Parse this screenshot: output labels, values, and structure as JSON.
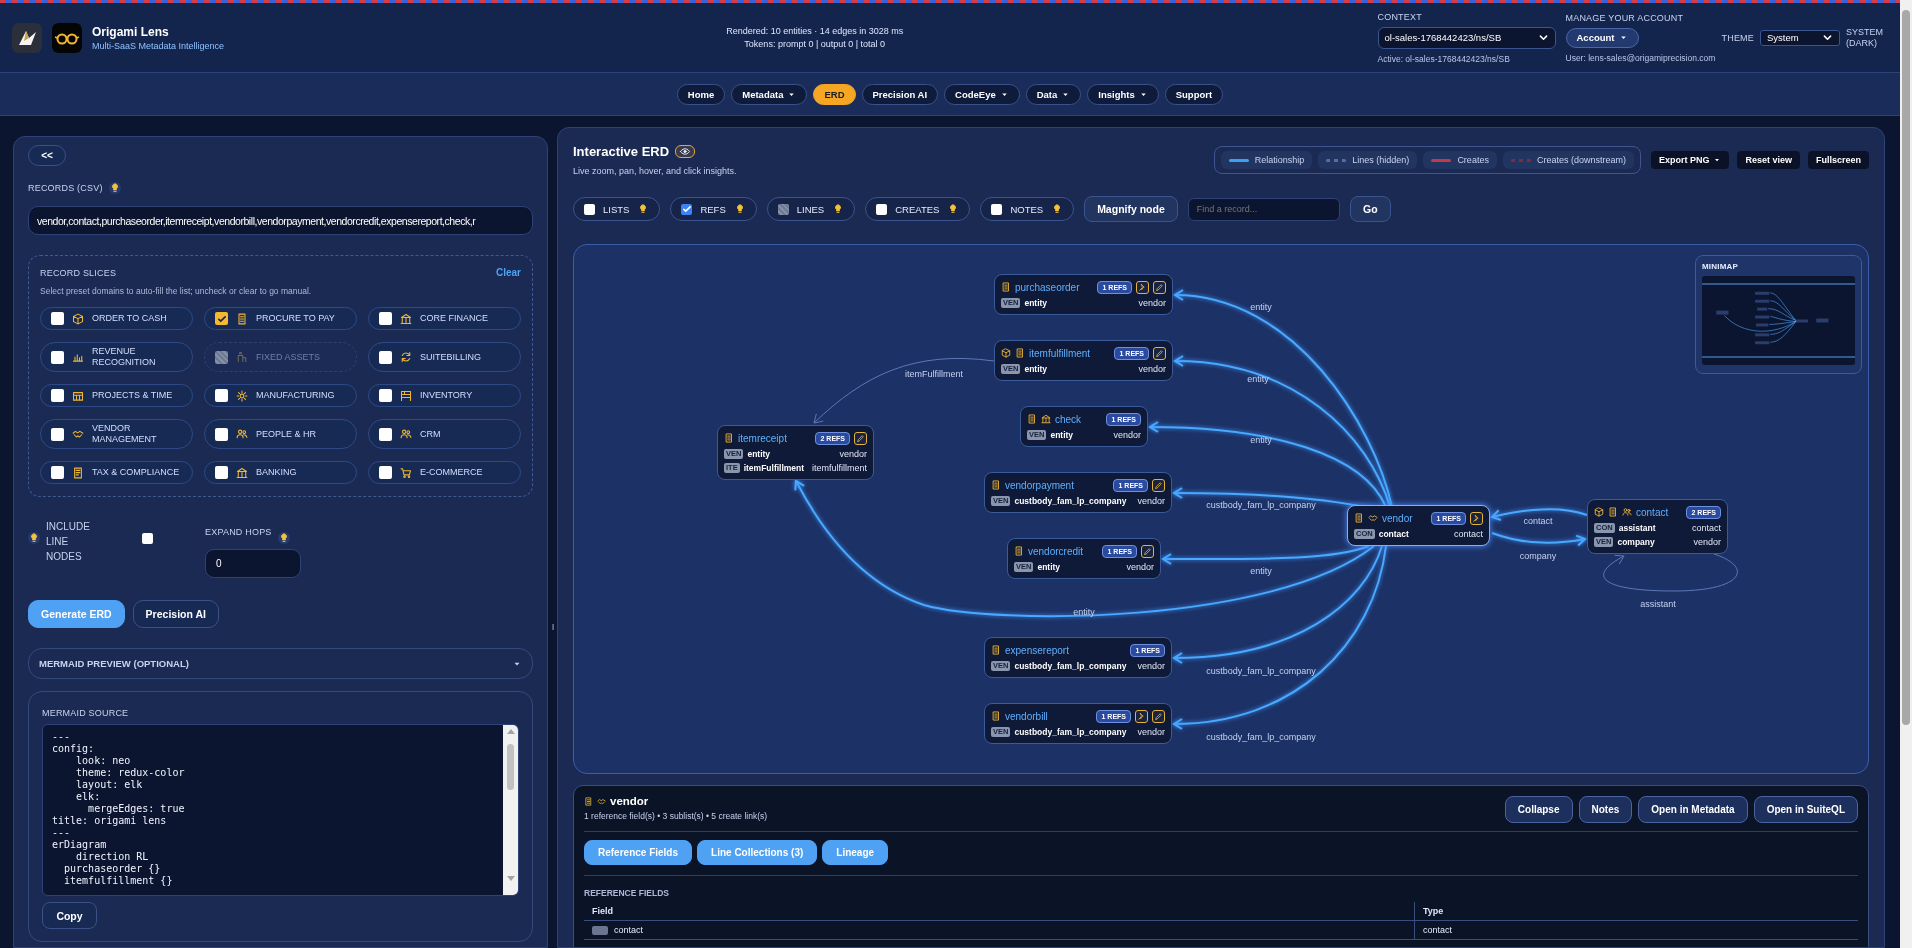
{
  "header": {
    "brand": {
      "title": "Origami Lens",
      "subtitle": "Multi-SaaS Metadata Intelligence"
    },
    "stats": [
      "Rendered: 10 entities · 14 edges in 3028 ms",
      "Tokens: prompt 0 | output 0 | total 0"
    ],
    "context": {
      "label": "CONTEXT",
      "value": "ol-sales-1768442423/ns/SB",
      "active": "Active: ol-sales-1768442423/ns/SB"
    },
    "account": {
      "label": "MANAGE YOUR ACCOUNT",
      "button": "Account",
      "user": "User: lens-sales@origamiprecision.com"
    },
    "theme": {
      "label": "THEME",
      "value": "System",
      "mode": "SYSTEM (DARK)"
    }
  },
  "nav": [
    {
      "label": "Home",
      "dropdown": false,
      "selected": false
    },
    {
      "label": "Metadata",
      "dropdown": true,
      "selected": false
    },
    {
      "label": "ERD",
      "dropdown": false,
      "selected": true
    },
    {
      "label": "Precision AI",
      "dropdown": false,
      "selected": false
    },
    {
      "label": "CodeEye",
      "dropdown": true,
      "selected": false
    },
    {
      "label": "Data",
      "dropdown": true,
      "selected": false
    },
    {
      "label": "Insights",
      "dropdown": true,
      "selected": false
    },
    {
      "label": "Support",
      "dropdown": false,
      "selected": false
    }
  ],
  "sidebar": {
    "collapse": "<<",
    "records": {
      "label": "RECORDS (CSV)",
      "value": "vendor,contact,purchaseorder,itemreceipt,vendorbill,vendorpayment,vendorcredit,expensereport,check,r"
    },
    "slices": {
      "title": "RECORD SLICES",
      "clear": "Clear",
      "hint": "Select preset domains to auto-fill the list; uncheck or clear to go manual.",
      "items": [
        {
          "label": "ORDER TO CASH",
          "checked": false,
          "disabled": false
        },
        {
          "label": "PROCURE TO PAY",
          "checked": true,
          "disabled": false
        },
        {
          "label": "CORE FINANCE",
          "checked": false,
          "disabled": false
        },
        {
          "label": "REVENUE RECOGNITION",
          "checked": false,
          "disabled": false
        },
        {
          "label": "FIXED ASSETS",
          "checked": false,
          "disabled": true
        },
        {
          "label": "SUITEBILLING",
          "checked": false,
          "disabled": false
        },
        {
          "label": "PROJECTS & TIME",
          "checked": false,
          "disabled": false
        },
        {
          "label": "MANUFACTURING",
          "checked": false,
          "disabled": false
        },
        {
          "label": "INVENTORY",
          "checked": false,
          "disabled": false
        },
        {
          "label": "VENDOR MANAGEMENT",
          "checked": false,
          "disabled": false
        },
        {
          "label": "PEOPLE & HR",
          "checked": false,
          "disabled": false
        },
        {
          "label": "CRM",
          "checked": false,
          "disabled": false
        },
        {
          "label": "TAX & COMPLIANCE",
          "checked": false,
          "disabled": false
        },
        {
          "label": "BANKING",
          "checked": false,
          "disabled": false
        },
        {
          "label": "E-COMMERCE",
          "checked": false,
          "disabled": false
        }
      ]
    },
    "include_line_nodes": {
      "label": "INCLUDE LINE NODES",
      "checked": false
    },
    "expand_hops": {
      "label": "EXPAND HOPS",
      "value": "0"
    },
    "buttons": [
      {
        "label": "Generate ERD",
        "primary": true
      },
      {
        "label": "Precision AI",
        "primary": false
      }
    ],
    "mermaid_preview": {
      "label": "MERMAID PREVIEW (OPTIONAL)",
      "expanded": false
    },
    "mermaid_source": {
      "label": "MERMAID SOURCE",
      "code": "---\nconfig:\n    look: neo\n    theme: redux-color\n    layout: elk\n    elk:\n      mergeEdges: true\ntitle: origami lens\n---\nerDiagram\n    direction RL\n  purchaseorder {}\n  itemfulfillment {}",
      "copy": "Copy"
    }
  },
  "erd": {
    "title": "Interactive ERD",
    "subtitle": "Live zoom, pan, hover, and click insights.",
    "legend": [
      {
        "label": "Relationship",
        "kind": "solid",
        "color": "#3aa0f0"
      },
      {
        "label": "Lines (hidden)",
        "kind": "dashed",
        "color": "#5a6f9c"
      },
      {
        "label": "Creates",
        "kind": "solid",
        "color": "#c0394f"
      },
      {
        "label": "Creates (downstream)",
        "kind": "dashed",
        "color": "#7a2e45"
      }
    ],
    "actions": [
      {
        "label": "Export PNG",
        "dropdown": true
      },
      {
        "label": "Reset view",
        "dropdown": false
      },
      {
        "label": "Fullscreen",
        "dropdown": false
      }
    ],
    "toggles": [
      {
        "label": "LISTS",
        "checked": false,
        "disabled": false
      },
      {
        "label": "REFS",
        "checked": true,
        "disabled": false
      },
      {
        "label": "LINES",
        "checked": false,
        "disabled": true
      },
      {
        "label": "CREATES",
        "checked": false,
        "disabled": false
      },
      {
        "label": "NOTES",
        "checked": false,
        "disabled": false
      }
    ],
    "magnify": "Magnify node",
    "search": {
      "placeholder": "Find a record..."
    },
    "go": "Go",
    "canvas": {
      "nodes": [
        {
          "name": "purchaseorder",
          "refs": "1 REFS",
          "selected": false,
          "rows": [
            {
              "tag": "VEN",
              "field": "entity",
              "type": "vendor"
            }
          ]
        },
        {
          "name": "itemfulfillment",
          "refs": "1 REFS",
          "selected": false,
          "rows": [
            {
              "tag": "VEN",
              "field": "entity",
              "type": "vendor"
            }
          ]
        },
        {
          "name": "check",
          "refs": "1 REFS",
          "selected": false,
          "rows": [
            {
              "tag": "VEN",
              "field": "entity",
              "type": "vendor"
            }
          ]
        },
        {
          "name": "itemreceipt",
          "refs": "2 REFS",
          "selected": false,
          "rows": [
            {
              "tag": "VEN",
              "field": "entity",
              "type": "vendor"
            },
            {
              "tag": "ITE",
              "field": "itemFulfillment",
              "type": "itemfulfillment"
            }
          ]
        },
        {
          "name": "vendorpayment",
          "refs": "1 REFS",
          "selected": false,
          "rows": [
            {
              "tag": "VEN",
              "field": "custbody_fam_lp_company",
              "type": "vendor"
            }
          ]
        },
        {
          "name": "vendorcredit",
          "refs": "1 REFS",
          "selected": false,
          "rows": [
            {
              "tag": "VEN",
              "field": "entity",
              "type": "vendor"
            }
          ]
        },
        {
          "name": "expensereport",
          "refs": "1 REFS",
          "selected": false,
          "rows": [
            {
              "tag": "VEN",
              "field": "custbody_fam_lp_company",
              "type": "vendor"
            }
          ]
        },
        {
          "name": "vendorbill",
          "refs": "1 REFS",
          "selected": false,
          "rows": [
            {
              "tag": "VEN",
              "field": "custbody_fam_lp_company",
              "type": "vendor"
            }
          ]
        },
        {
          "name": "vendor",
          "refs": "1 REFS",
          "selected": true,
          "rows": [
            {
              "tag": "CON",
              "field": "contact",
              "type": "contact"
            }
          ]
        },
        {
          "name": "contact",
          "refs": "2 REFS",
          "selected": false,
          "rows": [
            {
              "tag": "CON",
              "field": "assistant",
              "type": "contact"
            },
            {
              "tag": "VEN",
              "field": "company",
              "type": "vendor"
            }
          ]
        }
      ],
      "edges": [
        {
          "label": "entity",
          "kind": "relationship"
        },
        {
          "label": "entity",
          "kind": "relationship"
        },
        {
          "label": "entity",
          "kind": "relationship"
        },
        {
          "label": "custbody_fam_lp_company",
          "kind": "relationship"
        },
        {
          "label": "entity",
          "kind": "relationship"
        },
        {
          "label": "entity",
          "kind": "relationship"
        },
        {
          "label": "custbody_fam_lp_company",
          "kind": "relationship"
        },
        {
          "label": "custbody_fam_lp_company",
          "kind": "relationship"
        },
        {
          "label": "contact",
          "kind": "relationship"
        },
        {
          "label": "company",
          "kind": "relationship"
        },
        {
          "label": "assistant",
          "kind": "faint"
        },
        {
          "label": "itemFulfillment",
          "kind": "faint"
        }
      ],
      "minimap": {
        "label": "MINIMAP"
      }
    }
  },
  "details": {
    "title": "vendor",
    "summary": "1 reference field(s) • 3 sublist(s) • 5 create link(s)",
    "actions": [
      "Collapse",
      "Notes",
      "Open in Metadata",
      "Open in SuiteQL"
    ],
    "sections": [
      "Reference Fields",
      "Line Collections (3)",
      "Lineage"
    ],
    "section_title": "REFERENCE FIELDS",
    "table": {
      "columns": [
        "Field",
        "Type"
      ],
      "rows": [
        {
          "field": "contact",
          "type": "contact"
        }
      ]
    }
  }
}
